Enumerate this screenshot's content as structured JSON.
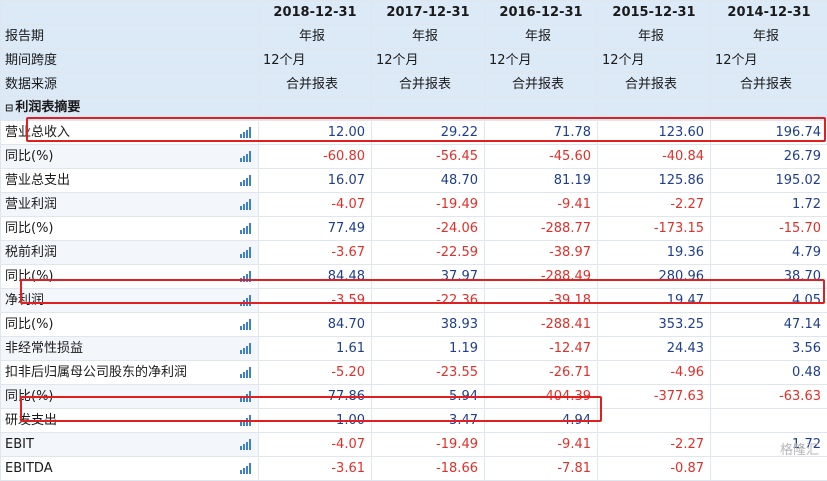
{
  "header": {
    "columns": [
      "2018-12-31",
      "2017-12-31",
      "2016-12-31",
      "2015-12-31",
      "2014-12-31"
    ],
    "first_label": "报告期"
  },
  "meta_rows": [
    {
      "label": "期间跨度",
      "values": [
        "12个月",
        "12个月",
        "12个月",
        "12个月",
        "12个月"
      ]
    },
    {
      "label": "数据来源",
      "values": [
        "合并报表",
        "合并报表",
        "合并报表",
        "合并报表",
        "合并报表"
      ]
    }
  ],
  "report_type_row": {
    "label": "报告期",
    "values": [
      "年报",
      "年报",
      "年报",
      "年报",
      "年报"
    ]
  },
  "section": {
    "label": "利润表摘要",
    "toggle": "⊟"
  },
  "rows": [
    {
      "label": "营业总收入",
      "values": [
        "12.00",
        "29.22",
        "71.78",
        "123.60",
        "196.74"
      ]
    },
    {
      "label": "同比(%)",
      "values": [
        "-60.80",
        "-56.45",
        "-45.60",
        "-40.84",
        "26.79"
      ]
    },
    {
      "label": "营业总支出",
      "values": [
        "16.07",
        "48.70",
        "81.19",
        "125.86",
        "195.02"
      ]
    },
    {
      "label": "营业利润",
      "values": [
        "-4.07",
        "-19.49",
        "-9.41",
        "-2.27",
        "1.72"
      ]
    },
    {
      "label": "同比(%)",
      "values": [
        "77.49",
        "-24.06",
        "-288.77",
        "-173.15",
        "-15.70"
      ]
    },
    {
      "label": "税前利润",
      "values": [
        "-3.67",
        "-22.59",
        "-38.97",
        "19.36",
        "4.79"
      ]
    },
    {
      "label": "同比(%)",
      "values": [
        "84.48",
        "37.97",
        "-288.49",
        "280.96",
        "38.70"
      ]
    },
    {
      "label": "净利润",
      "values": [
        "-3.59",
        "-22.36",
        "-39.18",
        "19.47",
        "4.05"
      ]
    },
    {
      "label": "同比(%)",
      "values": [
        "84.70",
        "38.93",
        "-288.41",
        "353.25",
        "47.14"
      ]
    },
    {
      "label": "非经常性损益",
      "values": [
        "1.61",
        "1.19",
        "-12.47",
        "24.43",
        "3.56"
      ]
    },
    {
      "label": "扣非后归属母公司股东的净利润",
      "values": [
        "-5.20",
        "-23.55",
        "-26.71",
        "-4.96",
        "0.48"
      ]
    },
    {
      "label": "同比(%)",
      "values": [
        "77.86",
        "5.94",
        "-404.39",
        "-377.63",
        "-63.63"
      ]
    },
    {
      "label": "研发支出",
      "values": [
        "1.00",
        "3.47",
        "4.94",
        "",
        ""
      ]
    },
    {
      "label": "EBIT",
      "values": [
        "-4.07",
        "-19.49",
        "-9.41",
        "-2.27",
        "1.72"
      ]
    },
    {
      "label": "EBITDA",
      "values": [
        "-3.61",
        "-18.66",
        "-7.81",
        "-0.87",
        ""
      ]
    }
  ],
  "watermark": "格隆汇",
  "colors": {
    "negative": "#e0302a",
    "positive": "#1f3f8a",
    "header_bg": "#dce9f7",
    "highlight": "#e02020"
  }
}
